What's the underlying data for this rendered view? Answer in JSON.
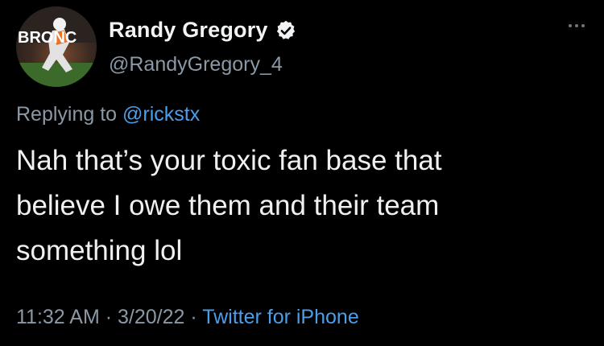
{
  "tweet": {
    "author": {
      "display_name": "Randy Gregory",
      "handle": "@RandyGregory_4",
      "verified": true,
      "avatar_icon": "player-avatar-icon",
      "avatar_text": "BRONC"
    },
    "reply": {
      "prefix": "Replying to ",
      "target": "@rickstx"
    },
    "text": "Nah that’s your toxic fan base that\nbelieve I owe them and their team\nsomething lol",
    "meta": {
      "time": "11:32 AM",
      "separator": " · ",
      "date": "3/20/22",
      "source": "Twitter for iPhone"
    },
    "icons": {
      "verified": "verified-badge-icon",
      "more": "more-options-icon"
    },
    "colors": {
      "background": "#000000",
      "link": "#4a9eea",
      "secondary_text": "#8b98a5",
      "primary_text": "#eef0f1"
    }
  }
}
